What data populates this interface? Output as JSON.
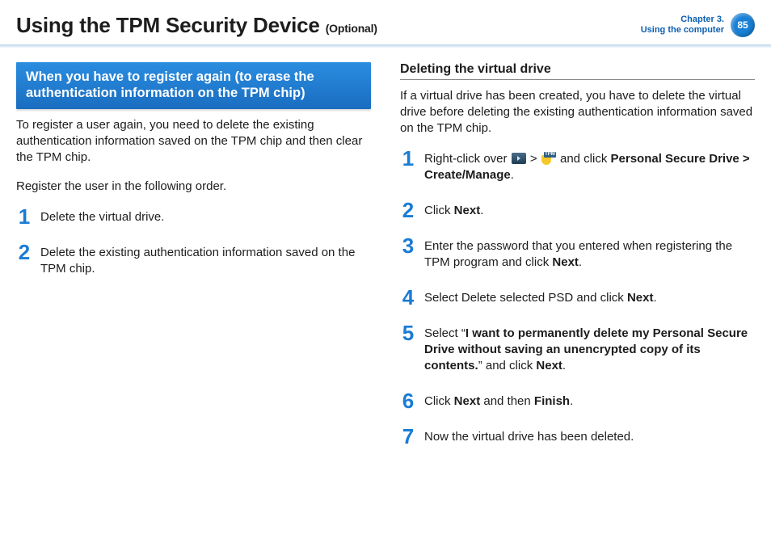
{
  "header": {
    "title": "Using the TPM Security Device",
    "title_suffix": "(Optional)",
    "chapter_line1": "Chapter 3.",
    "chapter_line2": "Using the computer",
    "page_number": "85"
  },
  "left": {
    "box_title": "When you have to register again (to erase the authentication information on the TPM chip)",
    "para1": "To register a user again, you need to delete the existing authentication information saved on the TPM chip and then clear the TPM chip.",
    "para2": "Register the user in the following order.",
    "steps": [
      {
        "text": "Delete the virtual drive."
      },
      {
        "text": "Delete the existing authentication information saved on the TPM chip."
      }
    ]
  },
  "right": {
    "heading": "Deleting the virtual drive",
    "intro": "If a virtual drive has been created, you have to delete the virtual drive before deleting the existing authentication information saved on the TPM chip.",
    "steps": [
      {
        "pre": "Right-click over ",
        "sep": " > ",
        "mid": " and click ",
        "bold1": "Personal Secure Drive > Create/Manage",
        "post": "."
      },
      {
        "pre": "Click ",
        "bold1": "Next",
        "post": "."
      },
      {
        "pre": "Enter the password that you entered when registering the TPM program and click ",
        "bold1": "Next",
        "post": "."
      },
      {
        "pre": "Select Delete selected PSD and click ",
        "bold1": "Next",
        "post": "."
      },
      {
        "pre": "Select “",
        "bold1": "I want to permanently delete my Personal Secure Drive without saving an unencrypted copy of its contents.",
        "mid": "” and click ",
        "bold2": "Next",
        "post": "."
      },
      {
        "pre": "Click ",
        "bold1": "Next",
        "mid": " and then ",
        "bold2": "Finish",
        "post": "."
      },
      {
        "pre": "Now the virtual drive has been deleted."
      }
    ]
  }
}
